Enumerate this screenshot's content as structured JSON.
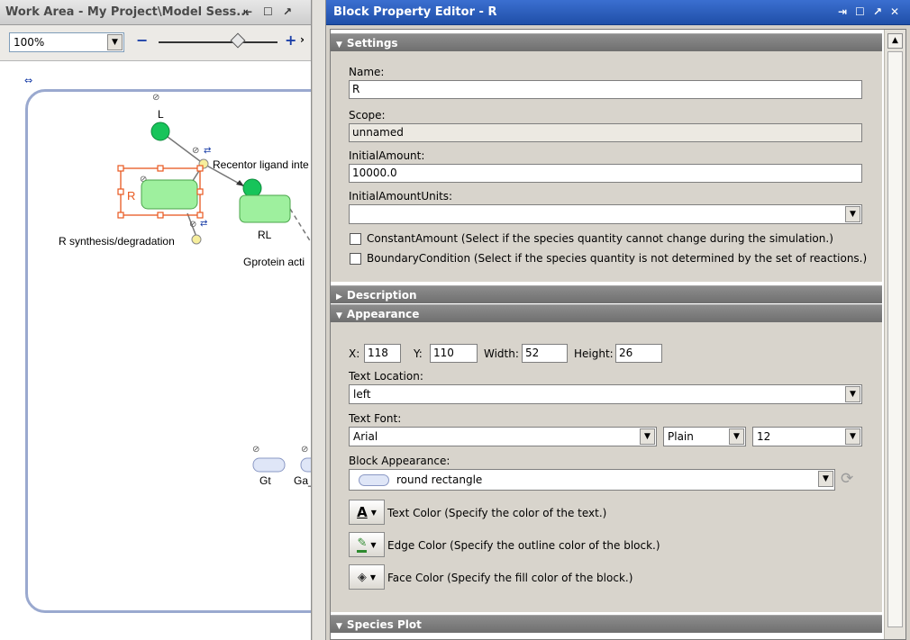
{
  "work_area": {
    "title": "Work Area - My Project\\Model Sess...",
    "title_controls": [
      "⇤",
      "☐",
      "↗"
    ],
    "zoom": {
      "value": "100%",
      "minus": "−",
      "plus": "+",
      "more": "›"
    },
    "diagram": {
      "species": [
        "L",
        "R",
        "RL",
        "Gt",
        "Ga_"
      ],
      "reactions": [
        "Recentor ligand inte",
        "R synthesis/degradation",
        "Gprotein acti"
      ]
    }
  },
  "editor": {
    "title": "Block Property Editor - R",
    "title_controls": [
      "⇥",
      "☐",
      "↗",
      "✕"
    ],
    "sections": {
      "settings": "Settings",
      "description": "Description",
      "appearance": "Appearance",
      "species_plot": "Species Plot"
    },
    "settings": {
      "name_label": "Name:",
      "name_value": "R",
      "scope_label": "Scope:",
      "scope_value": "unnamed",
      "initial_amount_label": "InitialAmount:",
      "initial_amount_value": "10000.0",
      "initial_amount_units_label": "InitialAmountUnits:",
      "initial_amount_units_value": "",
      "constant_amount": "ConstantAmount (Select if the species quantity cannot change during the simulation.)",
      "boundary_condition": "BoundaryCondition (Select if the species quantity is not determined by the set of reactions.)"
    },
    "appearance": {
      "x_label": "X:",
      "x_value": "118",
      "y_label": "Y:",
      "y_value": "110",
      "width_label": "Width:",
      "width_value": "52",
      "height_label": "Height:",
      "height_value": "26",
      "text_location_label": "Text Location:",
      "text_location_value": "left",
      "text_font_label": "Text Font:",
      "font_family": "Arial",
      "font_style": "Plain",
      "font_size": "12",
      "block_appearance_label": "Block Appearance:",
      "block_shape": "round rectangle",
      "text_color": "Text Color (Specify the color of the text.)",
      "edge_color": "Edge Color (Specify the outline color of the block.)",
      "face_color": "Face Color (Specify the fill color of the block.)"
    }
  },
  "colors": {
    "species_fill": "#9ef09e",
    "ligand_fill": "#17c45a",
    "selection": "#e8581f",
    "compartment": "#9aa9cf",
    "editor_title": "#2a5cc0"
  }
}
